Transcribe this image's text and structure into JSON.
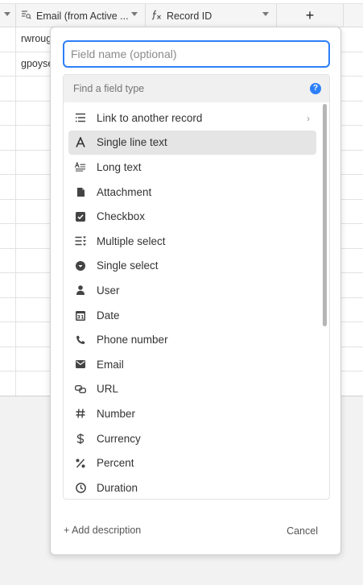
{
  "grid": {
    "columns": [
      {
        "label": "Email (from Active ...",
        "icon": "lookup-icon"
      },
      {
        "label": "Record ID",
        "icon": "formula-icon"
      }
    ],
    "add_column_label": "+",
    "rows": [
      "rwroug",
      "gpoyse",
      "",
      "",
      "",
      "",
      "",
      "",
      "",
      "",
      "",
      "",
      "",
      "",
      ""
    ]
  },
  "popup": {
    "field_name_placeholder": "Field name (optional)",
    "field_name_value": "",
    "finder_placeholder": "Find a field type",
    "help_label": "?",
    "field_types": [
      {
        "label": "Link to another record",
        "icon": "link-records-icon",
        "has_submenu": true,
        "chevron": "›"
      },
      {
        "label": "Single line text",
        "icon": "text-a-icon",
        "selected": true
      },
      {
        "label": "Long text",
        "icon": "long-text-icon"
      },
      {
        "label": "Attachment",
        "icon": "attachment-icon"
      },
      {
        "label": "Checkbox",
        "icon": "checkbox-icon"
      },
      {
        "label": "Multiple select",
        "icon": "multiple-select-icon"
      },
      {
        "label": "Single select",
        "icon": "single-select-icon"
      },
      {
        "label": "User",
        "icon": "user-icon"
      },
      {
        "label": "Date",
        "icon": "calendar-icon"
      },
      {
        "label": "Phone number",
        "icon": "phone-icon"
      },
      {
        "label": "Email",
        "icon": "envelope-icon"
      },
      {
        "label": "URL",
        "icon": "url-link-icon"
      },
      {
        "label": "Number",
        "icon": "hash-icon"
      },
      {
        "label": "Currency",
        "icon": "dollar-icon"
      },
      {
        "label": "Percent",
        "icon": "percent-icon"
      },
      {
        "label": "Duration",
        "icon": "clock-icon"
      }
    ],
    "add_description_label": "+ Add description",
    "cancel_label": "Cancel"
  },
  "colors": {
    "accent": "#2d7ff9",
    "selected_row": "#e5e5e5",
    "header_bg": "#f5f5f5"
  }
}
